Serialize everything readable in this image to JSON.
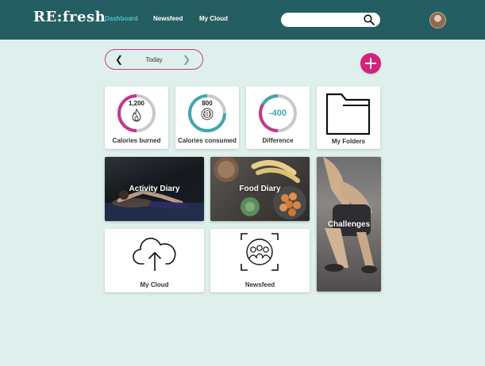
{
  "app": {
    "logo": "RE:fresh"
  },
  "nav": {
    "dashboard": "Dashboard",
    "newsfeed": "Newsfeed",
    "my_cloud": "My Cloud"
  },
  "search": {
    "value": "",
    "placeholder": ""
  },
  "date": {
    "label": "Today",
    "prev_icon": "chevron-left",
    "next_icon": "chevron-right"
  },
  "stats": {
    "burned": {
      "value": "1,200",
      "label": "Calories burned",
      "icon": "flame-icon"
    },
    "consumed": {
      "value": "800",
      "label": "Calories consumed",
      "icon": "cutlery-icon"
    },
    "difference": {
      "value": "-400",
      "label": "Difference"
    }
  },
  "tiles": {
    "folders": "My Folders",
    "activity": "Activity Diary",
    "food": "Food Diary",
    "challenges": "Challenges",
    "cloud": "My Cloud",
    "newsfeed": "Newsfeed"
  },
  "colors": {
    "header": "#245e62",
    "background": "#dff0ec",
    "magenta": "#c2398a",
    "teal": "#3fa7ad",
    "active_nav": "#55c0c4",
    "ring_track": "#c9c9c9"
  }
}
